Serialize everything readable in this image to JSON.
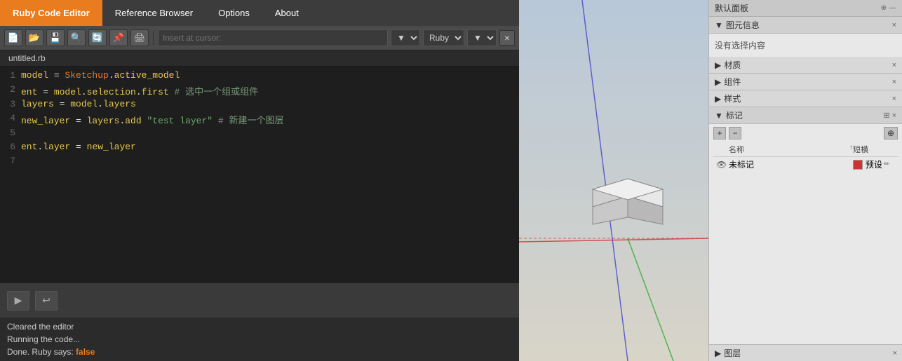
{
  "menu": {
    "items": [
      {
        "id": "ruby-code-editor",
        "label": "Ruby Code Editor",
        "active": true
      },
      {
        "id": "reference-browser",
        "label": "Reference Browser",
        "active": false
      },
      {
        "id": "options",
        "label": "Options",
        "active": false
      },
      {
        "id": "about",
        "label": "About",
        "active": false
      }
    ]
  },
  "toolbar": {
    "insert_placeholder": "Insert at cursor:",
    "language": "Ruby",
    "close_label": "×"
  },
  "file": {
    "tab_name": "untitled.rb"
  },
  "code": {
    "lines": [
      {
        "num": 1,
        "text": "model = Sketchup.active_model"
      },
      {
        "num": 2,
        "text": "ent = model.selection.first # 选中一个组或组件"
      },
      {
        "num": 3,
        "text": "layers = model.layers"
      },
      {
        "num": 4,
        "text": "new_layer = layers.add \"test layer\" # 新建一个图层"
      },
      {
        "num": 5,
        "text": ""
      },
      {
        "num": 6,
        "text": "ent.layer = new_layer"
      },
      {
        "num": 7,
        "text": ""
      }
    ]
  },
  "controls": {
    "play_label": "▶",
    "back_label": "↩"
  },
  "status": {
    "line1": "Cleared the editor",
    "line2": "Running the code...",
    "line3_prefix": "Done. Ruby says: ",
    "line3_value": "false"
  },
  "right_panel": {
    "panel_title": "默认面板",
    "pin1": "⊕",
    "pin2": "—",
    "sections": [
      {
        "id": "entity-info",
        "label": "图元信息",
        "expanded": true,
        "no_selection": "没有选择内容"
      },
      {
        "id": "materials",
        "label": "材质",
        "expanded": false
      },
      {
        "id": "components",
        "label": "组件",
        "expanded": false
      },
      {
        "id": "styles",
        "label": "样式",
        "expanded": false
      },
      {
        "id": "tags",
        "label": "标记",
        "expanded": true
      }
    ],
    "tags": {
      "buttons": [
        "+",
        "−",
        "⊕"
      ],
      "columns": [
        "名称",
        "短横"
      ],
      "rows": [
        {
          "eye": true,
          "name": "未标记",
          "color": "#cc3333",
          "short": "预设"
        }
      ]
    },
    "bottom_section": "图层"
  }
}
